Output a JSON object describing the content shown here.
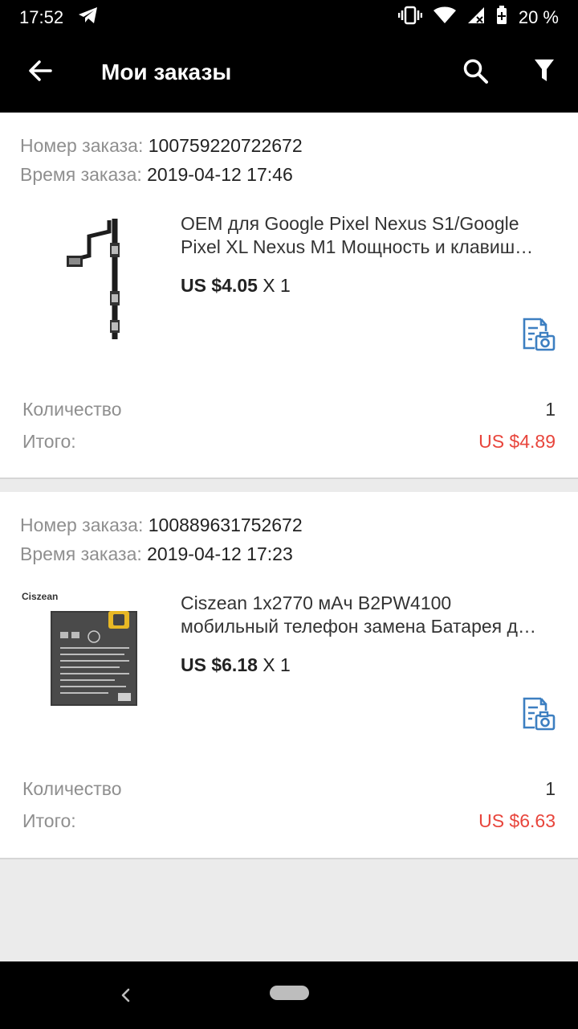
{
  "status_bar": {
    "time": "17:52",
    "battery": "20 %",
    "icons": [
      "telegram-icon",
      "vibrate-icon",
      "wifi-icon",
      "signal-icon",
      "battery-icon"
    ]
  },
  "app_bar": {
    "title": "Мои заказы",
    "icons": [
      "back-arrow-icon",
      "search-icon",
      "filter-icon"
    ]
  },
  "orders": [
    {
      "number_label": "Номер заказа:",
      "number": "100759220722672",
      "time_label": "Время заказа:",
      "time": "2019-04-12 17:46",
      "product_line1": "OEM для Google Pixel Nexus S1/Google",
      "product_line2": "Pixel XL Nexus M1 Мощность и клавиш…",
      "price": "US $4.05",
      "qty_mult": "X 1",
      "quantity_label": "Количество",
      "quantity": "1",
      "total_label": "Итого:",
      "total": "US $4.89"
    },
    {
      "number_label": "Номер заказа:",
      "number": "100889631752672",
      "time_label": "Время заказа:",
      "time": "2019-04-12 17:23",
      "thumb_brand": "Ciszean",
      "product_line1": "Ciszean 1x2770 мАч B2PW4100",
      "product_line2": "мобильный телефон замена Батарея д…",
      "price": "US $6.18",
      "qty_mult": "X 1",
      "quantity_label": "Количество",
      "quantity": "1",
      "total_label": "Итого:",
      "total": "US $6.63"
    }
  ],
  "colors": {
    "accent_red": "#e8453c",
    "icon_blue": "#3d7fc1",
    "bar_black": "#000000"
  }
}
